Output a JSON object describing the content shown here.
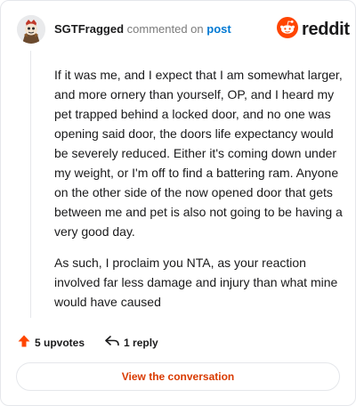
{
  "header": {
    "username": "SGTFragged",
    "action_text": "commented on",
    "post_link": "post"
  },
  "brand": {
    "wordmark": "reddit",
    "icon": "reddit-logo-icon",
    "color": "#ff4500"
  },
  "comment": {
    "paragraphs": [
      "If it was me, and I expect that I am somewhat larger, and more ornery than yourself, OP, and I heard my pet trapped behind a locked door, and no one was opening said door, the doors life expectancy would be severely reduced. Either it's coming down under my weight, or I'm off to find a battering ram. Anyone on the other side of the now opened door that gets between me and pet is also not going to be having a very good day.",
      "As such, I proclaim you NTA, as your reaction involved far less damage and injury than what mine would have caused"
    ]
  },
  "actions": {
    "upvotes_label": "5 upvotes",
    "upvote_icon": "upvote-arrow-icon",
    "reply_label": "1 reply",
    "reply_icon": "reply-arrow-icon"
  },
  "footer": {
    "view_conversation_label": "View the conversation"
  },
  "colors": {
    "accent": "#d93a00",
    "link": "#0079d3",
    "upvote": "#ff4500",
    "border": "#e5e7eb"
  }
}
